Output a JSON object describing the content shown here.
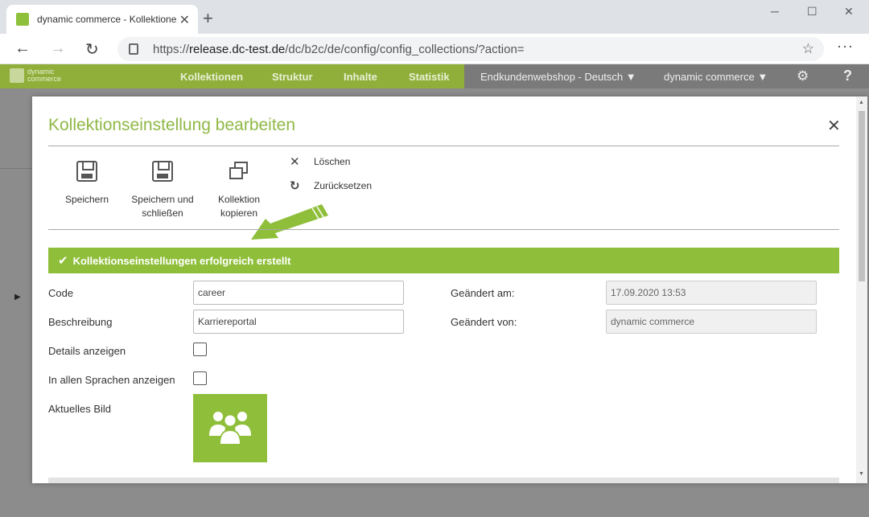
{
  "browser": {
    "tab_title": "dynamic commerce - Kollektione",
    "url_scheme": "https://",
    "url_host": "release.dc-test.de",
    "url_path": "/dc/b2c/de/config/config_collections/?action="
  },
  "appbar": {
    "logo_line1": "dynamic",
    "logo_line2": "commerce",
    "nav": [
      "Kollektionen",
      "Struktur",
      "Inhalte",
      "Statistik"
    ],
    "shop_select": "Endkundenwebshop - Deutsch",
    "company_select": "dynamic commerce"
  },
  "modal": {
    "title": "Kollektionseinstellung bearbeiten",
    "toolbar": {
      "save": "Speichern",
      "save_close_1": "Speichern und",
      "save_close_2": "schließen",
      "copy_1": "Kollektion",
      "copy_2": "kopieren",
      "delete": "Löschen",
      "reset": "Zurücksetzen"
    },
    "success_message": "Kollektionseinstellungen erfolgreich erstellt",
    "form": {
      "code_label": "Code",
      "code_value": "career",
      "description_label": "Beschreibung",
      "description_value": "Karriereportal",
      "show_details_label": "Details anzeigen",
      "show_all_languages_label": "In allen Sprachen anzeigen",
      "current_image_label": "Aktuelles Bild",
      "changed_at_label": "Geändert am:",
      "changed_at_value": "17.09.2020 13:53",
      "changed_by_label": "Geändert von:",
      "changed_by_value": "dynamic commerce"
    }
  },
  "colors": {
    "brand_green": "#8fbf3a",
    "title_green": "#8fb845",
    "appbar_green": "#8faf3a"
  }
}
